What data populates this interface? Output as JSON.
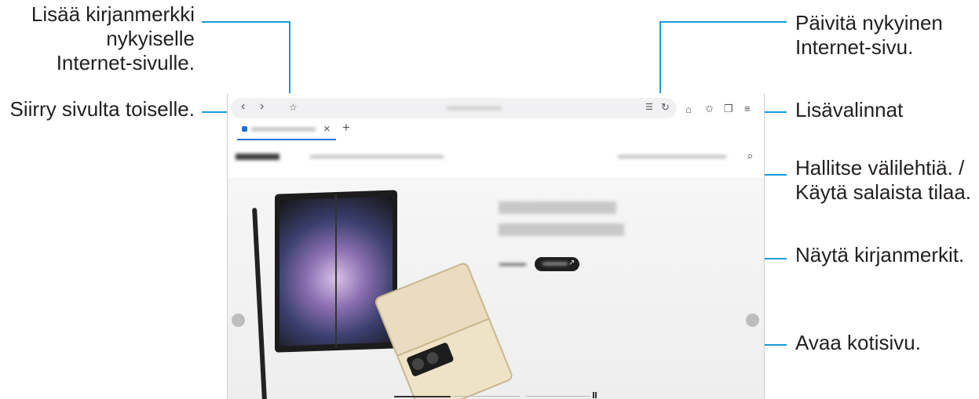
{
  "callouts": {
    "bookmark": [
      "Lisää kirjanmerkki",
      "nykyiselle",
      "Internet-sivulle."
    ],
    "nav": "Siirry sivulta toiselle.",
    "refresh": [
      "Päivitä nykyinen",
      "Internet-sivu."
    ],
    "options": "Lisävalinnat",
    "tabs": [
      "Hallitse välilehtiä. /",
      "Käytä salaista tilaa."
    ],
    "bookmarks": "Näytä kirjanmerkit.",
    "home": "Avaa kotisivu."
  },
  "browser": {
    "tab_close": "×",
    "new_tab": "+"
  },
  "colors": {
    "leader": "#1a9bd7",
    "accent": "#2a6fdb"
  },
  "icons": {
    "back": "chevron-left-icon",
    "forward": "chevron-right-icon",
    "bookmark_add": "star-outline-icon",
    "refresh": "refresh-icon",
    "home": "home-icon",
    "bookmarks": "star-icon",
    "tabs": "tabs-icon",
    "menu": "menu-icon",
    "search": "search-icon"
  }
}
